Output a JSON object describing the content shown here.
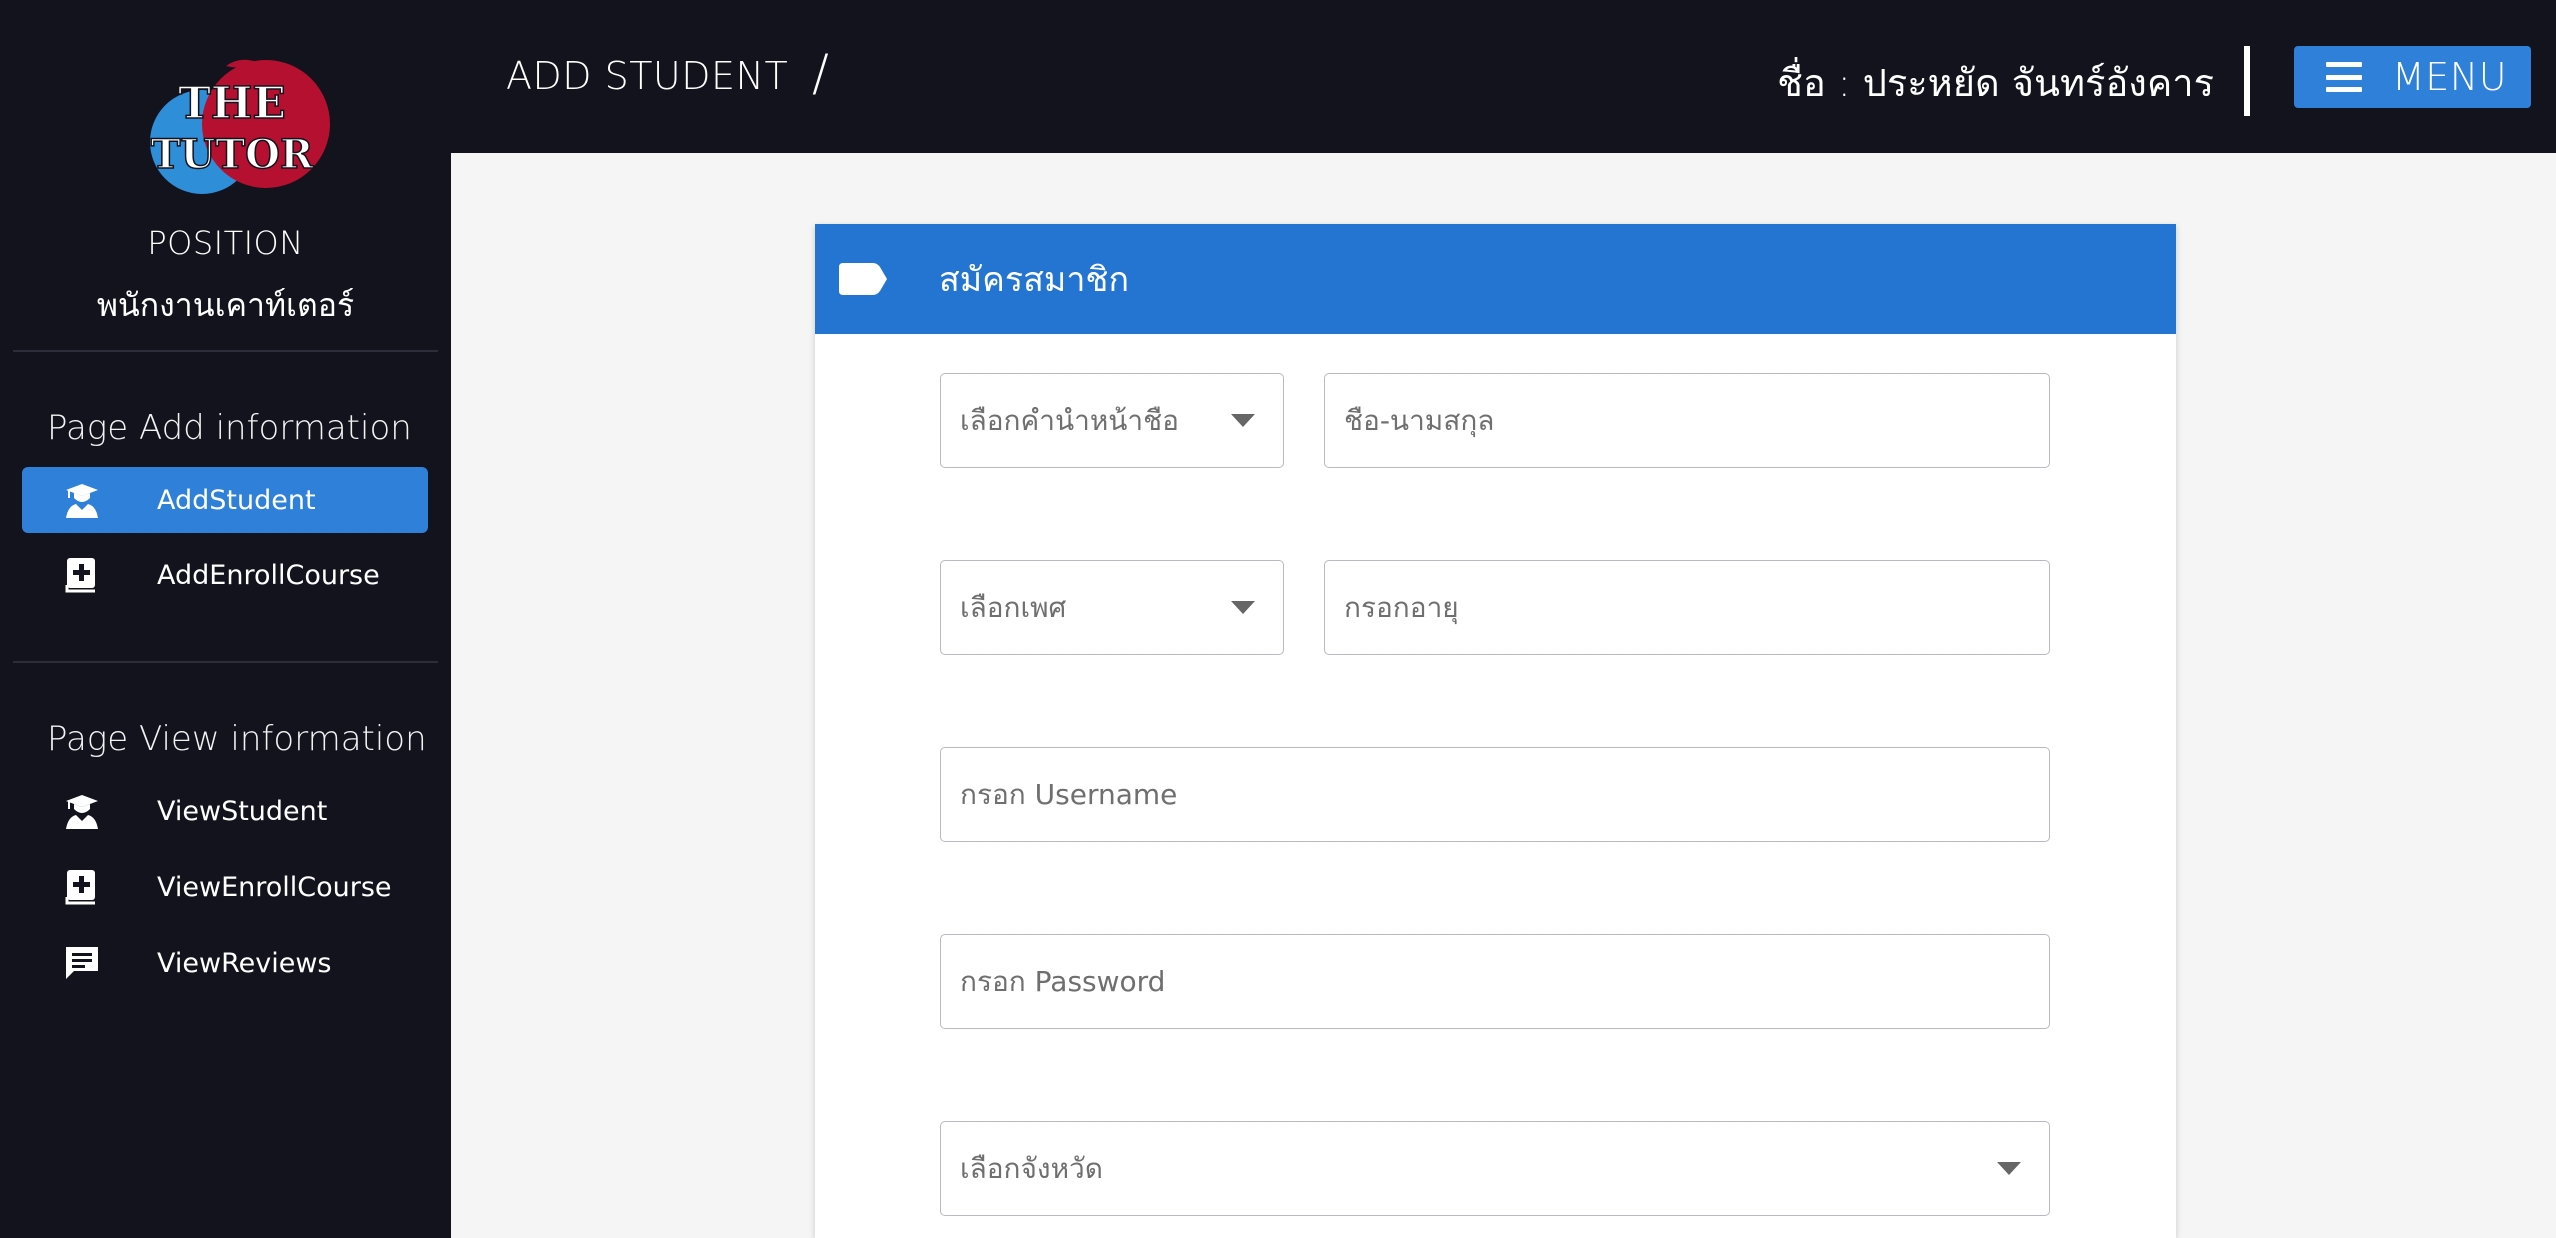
{
  "sidebar": {
    "logo_text_line1": "THE",
    "logo_text_line2": "TUTOR",
    "position_title": "POSITION",
    "position_name": "พนักงานเคาท์เตอร์",
    "sections": [
      {
        "title": "Page Add information",
        "items": [
          {
            "label": "AddStudent",
            "icon": "student-icon",
            "active": true
          },
          {
            "label": "AddEnrollCourse",
            "icon": "add-book-icon",
            "active": false
          }
        ]
      },
      {
        "title": "Page View information",
        "items": [
          {
            "label": "ViewStudent",
            "icon": "student-icon",
            "active": false
          },
          {
            "label": "ViewEnrollCourse",
            "icon": "add-book-icon",
            "active": false
          },
          {
            "label": "ViewReviews",
            "icon": "message-icon",
            "active": false
          }
        ]
      }
    ]
  },
  "header": {
    "page_title": "ADD STUDENT",
    "separator": "/",
    "user_name": "ชื่อ : ประหยัด จันทร์อังคาร",
    "menu_label": "MENU"
  },
  "form": {
    "title": "สมัครสมาชิก",
    "prefix_select": "เลือกคำนำหน้าชือ",
    "fullname_placeholder": "ชือ-นามสกุล",
    "gender_select": "เลือกเพศ",
    "age_placeholder": "กรอกอายุ",
    "username_placeholder": "กรอก Username",
    "password_placeholder": "กรอก Password",
    "province_select": "เลือกจังหวัด"
  },
  "colors": {
    "dark_bg": "#13131d",
    "accent": "#2e80d8",
    "card_header": "#2475d1",
    "logo_red": "#b5102f",
    "logo_blue": "#2e8fd8"
  }
}
